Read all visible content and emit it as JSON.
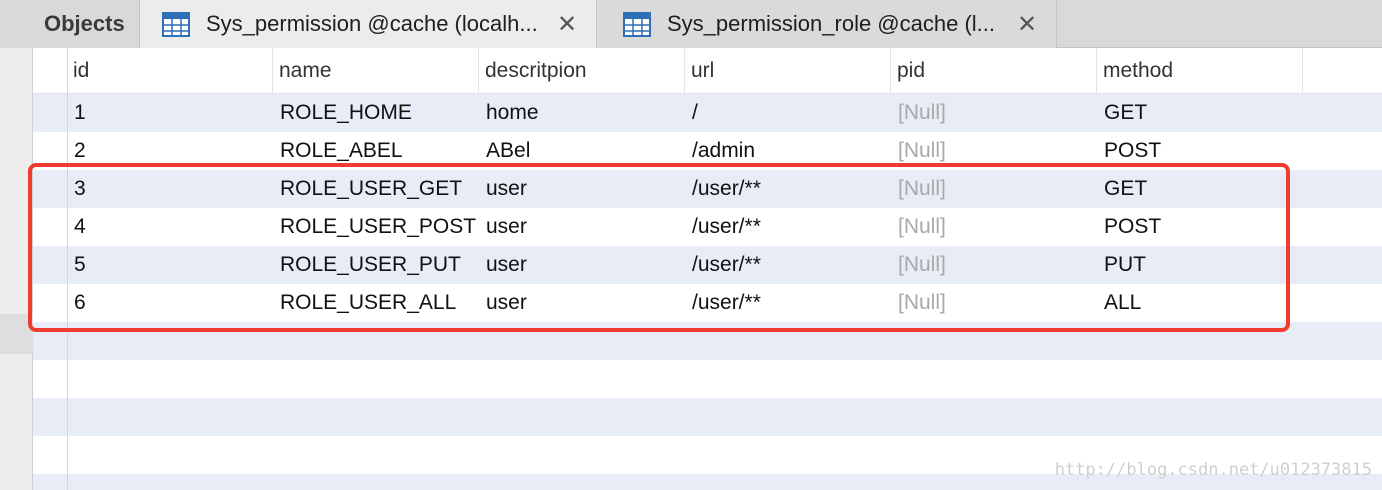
{
  "tabs": [
    {
      "label": "Objects"
    },
    {
      "label": "Sys_permission @cache (localh..."
    },
    {
      "label": "Sys_permission_role @cache (l..."
    }
  ],
  "close_glyph": "✕",
  "columns": [
    "id",
    "name",
    "descritpion",
    "url",
    "pid",
    "method"
  ],
  "rows": [
    {
      "id": "1",
      "name": "ROLE_HOME",
      "descritpion": "home",
      "url": "/",
      "pid": "[Null]",
      "method": "GET"
    },
    {
      "id": "2",
      "name": "ROLE_ABEL",
      "descritpion": "ABel",
      "url": "/admin",
      "pid": "[Null]",
      "method": "POST"
    },
    {
      "id": "3",
      "name": "ROLE_USER_GET",
      "descritpion": "user",
      "url": "/user/**",
      "pid": "[Null]",
      "method": "GET"
    },
    {
      "id": "4",
      "name": "ROLE_USER_POST",
      "descritpion": "user",
      "url": "/user/**",
      "pid": "[Null]",
      "method": "POST"
    },
    {
      "id": "5",
      "name": "ROLE_USER_PUT",
      "descritpion": "user",
      "url": "/user/**",
      "pid": "[Null]",
      "method": "PUT"
    },
    {
      "id": "6",
      "name": "ROLE_USER_ALL",
      "descritpion": "user",
      "url": "/user/**",
      "pid": "[Null]",
      "method": "ALL"
    }
  ],
  "watermark": "http://blog.csdn.net/u012373815",
  "colors": {
    "row_stripe": "#e8ecf6",
    "highlight_border": "#f03c2f",
    "null_text": "#a9a9a9",
    "tabbar_bg": "#d9d9d9"
  },
  "icons": {
    "table_icon": "table-icon",
    "close_icon": "close-icon"
  }
}
